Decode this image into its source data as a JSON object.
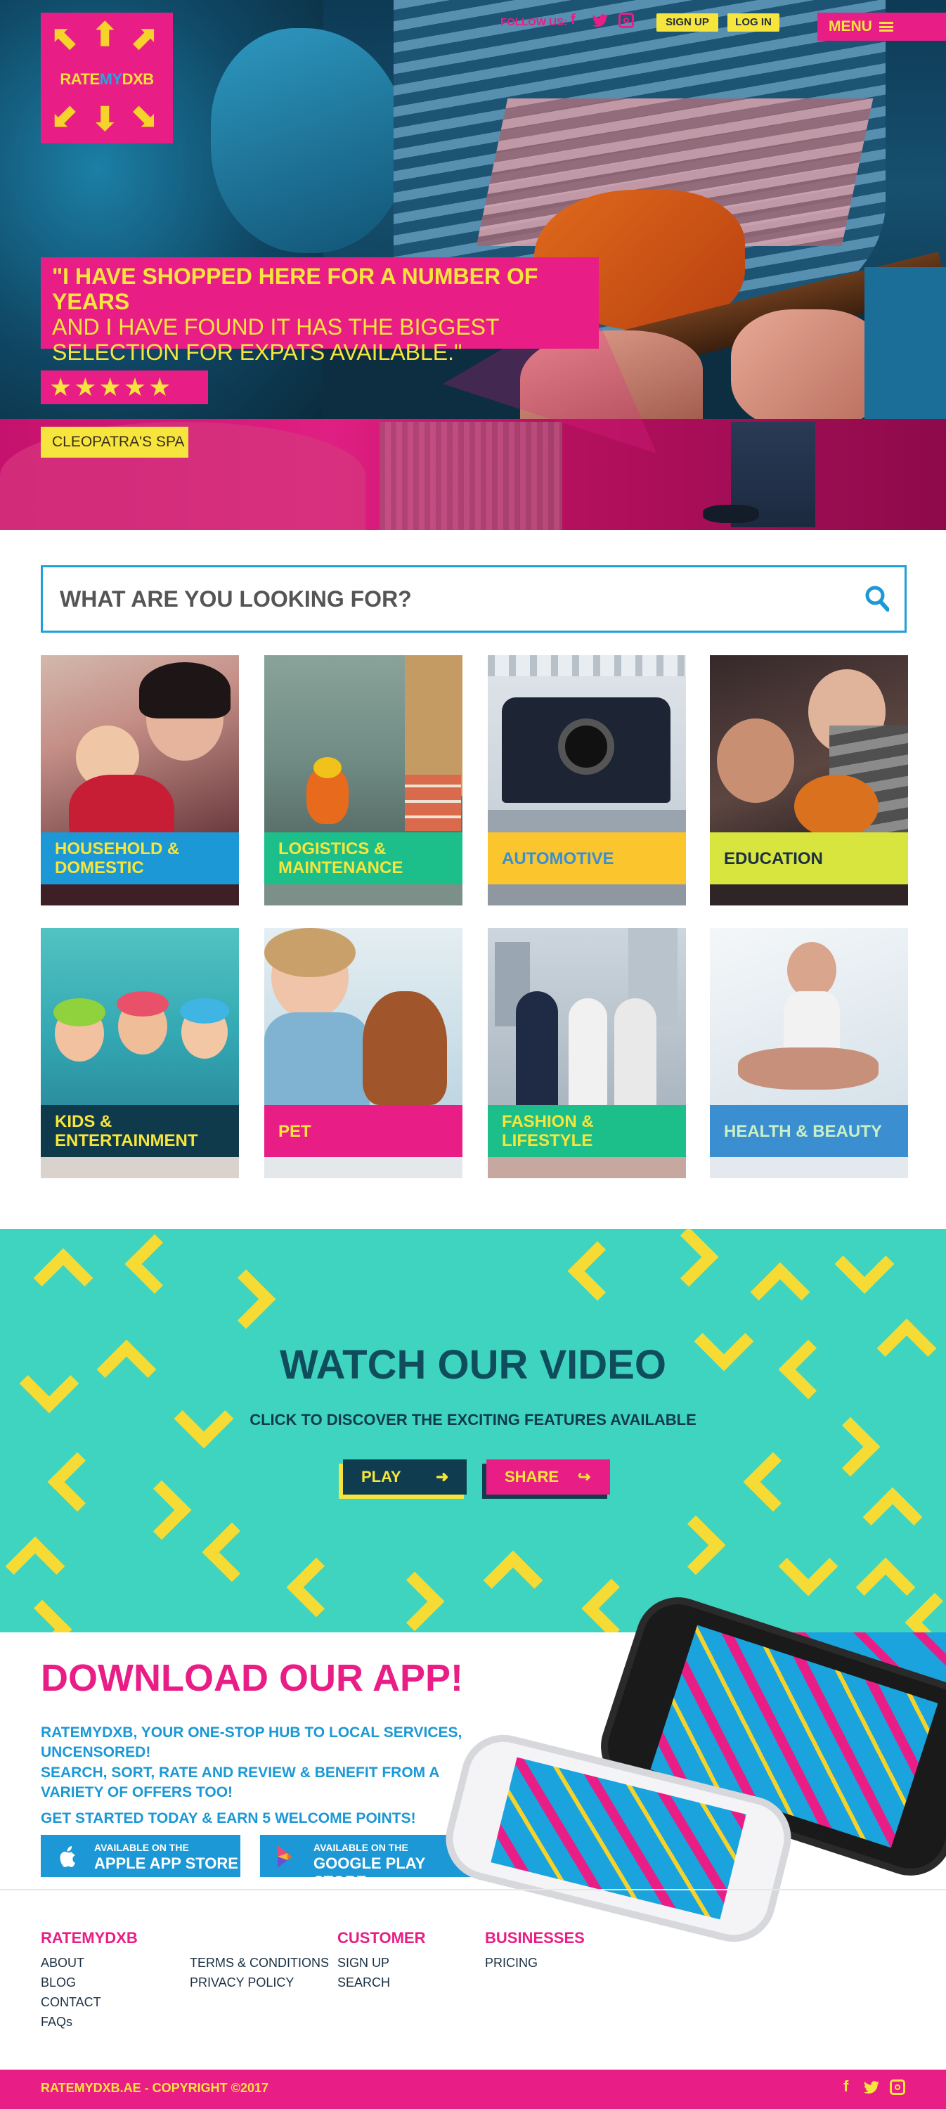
{
  "logo": {
    "rate": "RATE",
    "my": "MY",
    "dxb": "DXB"
  },
  "topbar": {
    "follow_label": "FOLLOW US:",
    "social": [
      "facebook-icon",
      "twitter-icon",
      "instagram-icon"
    ],
    "signup": "SIGN UP",
    "login": "LOG IN",
    "menu": "MENU"
  },
  "hero": {
    "quote_line1": "\"I HAVE SHOPPED HERE FOR A NUMBER OF YEARS",
    "quote_line2": "AND I HAVE FOUND IT HAS THE BIGGEST",
    "quote_line3": "SELECTION FOR EXPATS AVAILABLE.\"",
    "rating": 5,
    "stars": "★★★★★",
    "business": "CLEOPATRA'S SPA"
  },
  "search": {
    "placeholder": "WHAT ARE YOU LOOKING FOR?"
  },
  "categories": [
    {
      "line1": "HOUSEHOLD &",
      "line2": "DOMESTIC",
      "color": "#1b98d5",
      "text_color": "#f6e53c"
    },
    {
      "line1": "LOGISTICS &",
      "line2": "MAINTENANCE",
      "color": "#1cbf8a",
      "text_color": "#f6e53c"
    },
    {
      "line1": "AUTOMOTIVE",
      "line2": "",
      "color": "#fbc52d",
      "text_color": "#3b8fd0"
    },
    {
      "line1": "EDUCATION",
      "line2": "",
      "color": "#d7e53e",
      "text_color": "#1c3040"
    },
    {
      "line1": "KIDS &",
      "line2": "ENTERTAINMENT",
      "color": "#0e3a4c",
      "text_color": "#f6e53c"
    },
    {
      "line1": "PET",
      "line2": "",
      "color": "#e81e86",
      "text_color": "#f6e53c"
    },
    {
      "line1": "FASHION &",
      "line2": "LIFESTYLE",
      "color": "#1cbf8a",
      "text_color": "#f6e53c"
    },
    {
      "line1": "HEALTH & BEAUTY",
      "line2": "",
      "color": "#3b8ed0",
      "text_color": "#c9f0c5"
    }
  ],
  "video": {
    "title": "WATCH OUR VIDEO",
    "subtitle": "CLICK TO DISCOVER THE EXCITING FEATURES AVAILABLE",
    "play": "PLAY",
    "share": "SHARE"
  },
  "app": {
    "title": "DOWNLOAD OUR APP!",
    "line1": "RATEMYDXB, YOUR ONE-STOP HUB TO LOCAL SERVICES,",
    "line2": "UNCENSORED!",
    "line3": "SEARCH, SORT, RATE AND REVIEW & BENEFIT FROM A",
    "line4": "VARIETY OF OFFERS TOO!",
    "cta": "GET STARTED TODAY & EARN 5 WELCOME POINTS!",
    "apple_small": "AVAILABLE ON THE",
    "apple_big": "APPLE APP STORE",
    "google_small": "AVAILABLE ON THE",
    "google_big": "GOOGLE PLAY STORE"
  },
  "footer": {
    "col1_head": "RATEMYDXB",
    "col1": [
      "ABOUT",
      "BLOG",
      "CONTACT",
      "FAQs"
    ],
    "col2": [
      "TERMS & CONDITIONS",
      "PRIVACY POLICY"
    ],
    "col3_head": "CUSTOMER",
    "col3": [
      "SIGN UP",
      "SEARCH"
    ],
    "col4_head": "BUSINESSES",
    "col4": [
      "PRICING"
    ],
    "copyright": "RATEMYDXB.AE - COPYRIGHT ©2017",
    "social": [
      "facebook-icon",
      "twitter-icon",
      "instagram-icon"
    ]
  },
  "colors": {
    "pink": "#e81e86",
    "yellow": "#f6e53c",
    "blue": "#1b98d5",
    "teal": "#3fd4c0",
    "navy": "#0f4d5d"
  }
}
